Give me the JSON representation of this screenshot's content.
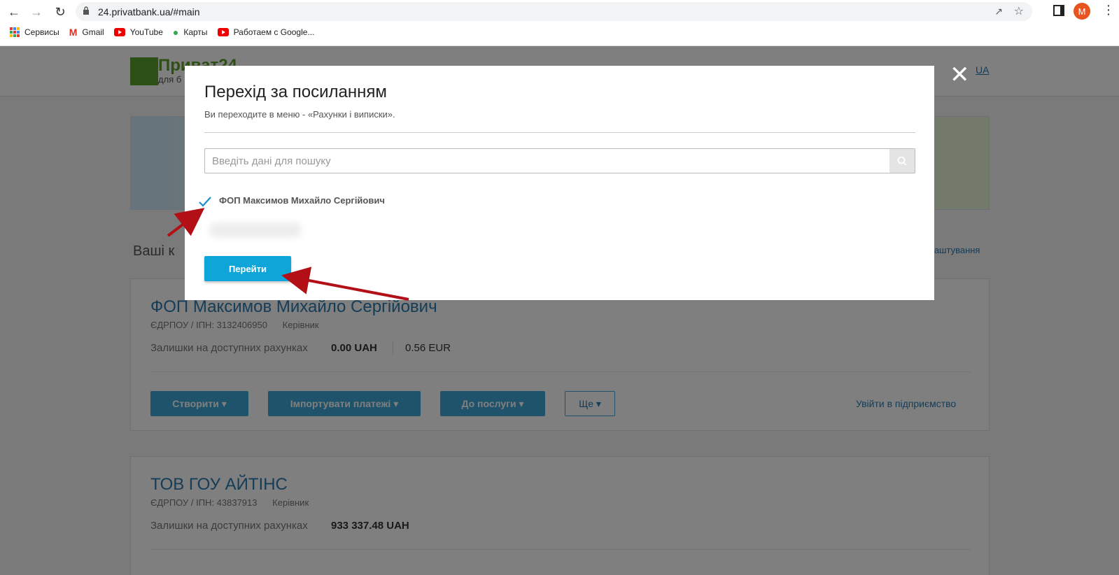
{
  "browser": {
    "url": "24.privatbank.ua/#main",
    "profile_initial": "M",
    "bookmarks": [
      {
        "label": "Сервисы",
        "icon": "apps-grid-icon"
      },
      {
        "label": "Gmail",
        "icon": "gmail-icon"
      },
      {
        "label": "YouTube",
        "icon": "youtube-icon"
      },
      {
        "label": "Карты",
        "icon": "maps-pin-icon"
      },
      {
        "label": "Работаем с Google...",
        "icon": "youtube-icon"
      }
    ]
  },
  "page": {
    "logo_text": "Приват24",
    "logo_sub": "для б",
    "lang": "UA",
    "section_title": "Ваші к",
    "settings_link": "алаштування",
    "companies": [
      {
        "name": "ФОП Максимов Михайло Сергійович",
        "meta": "ЄДРПОУ / ІПН: 3132406950",
        "role": "Керівник",
        "balance_label": "Залишки на доступних рахунках",
        "balance_uah": "0.00",
        "currency_uah": "UAH",
        "balance_eur": "0.56",
        "currency_eur": "EUR",
        "buttons": {
          "create": "Створити",
          "import": "Імпортувати платежі",
          "to_service": "До послуги",
          "more": "Ще"
        },
        "enter_link": "Увійти в підприємство"
      },
      {
        "name": "ТОВ ГОУ АЙТІНС",
        "meta": "ЄДРПОУ / ІПН: 43837913",
        "role": "Керівник",
        "balance_label": "Залишки на доступних рахунках",
        "balance_uah": "933 337.48",
        "currency_uah": "UAH"
      }
    ]
  },
  "modal": {
    "title": "Перехід за посиланням",
    "subtitle": "Ви переходите в меню - «Рахунки і виписки».",
    "search_placeholder": "Введіть дані для пошуку",
    "selected_option": "ФОП Максимов Михайло Сергійович",
    "go_button": "Перейти"
  },
  "colors": {
    "accent": "#0ea5d9",
    "arrow": "#b30f16",
    "check": "#1a8fd0"
  }
}
